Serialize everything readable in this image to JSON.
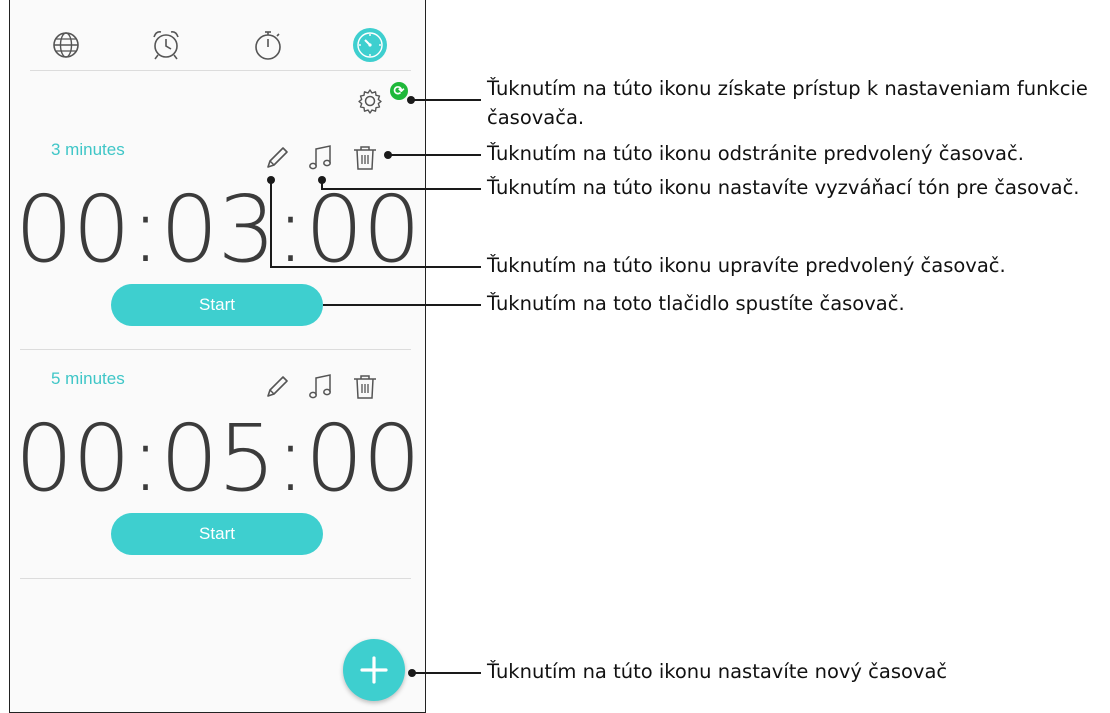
{
  "tabs": [
    {
      "name": "world-clock",
      "icon": "globe-icon"
    },
    {
      "name": "alarm",
      "icon": "alarm-clock-icon"
    },
    {
      "name": "stopwatch",
      "icon": "stopwatch-icon"
    },
    {
      "name": "timer",
      "icon": "timer-icon",
      "active": true
    }
  ],
  "presets": [
    {
      "name": "3 minutes",
      "time": "00:03:00",
      "start_label": "Start"
    },
    {
      "name": "5 minutes",
      "time": "00:05:00",
      "start_label": "Start"
    }
  ],
  "callouts": {
    "settings_line1": "Ťuknutím na túto ikonu získate prístup k nastaveniam funkcie",
    "settings_line2": "časovača.",
    "delete": "Ťuknutím na túto ikonu odstránite predvolený časovač.",
    "ringtone": "Ťuknutím na túto ikonu nastavíte vyzváňací tón pre časovač.",
    "edit": "Ťuknutím na túto ikonu upravíte predvolený časovač.",
    "start": "Ťuknutím na toto tlačidlo spustíte časovač.",
    "new_timer": "Ťuknutím na túto ikonu nastavíte nový časovač"
  },
  "colors": {
    "accent": "#3ecfcf",
    "accent_text": "#3fc6c7",
    "sync_badge": "#1fb83a",
    "icon_gray": "#555555"
  }
}
